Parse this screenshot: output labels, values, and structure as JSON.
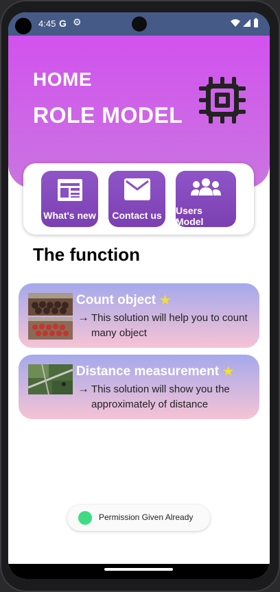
{
  "status": {
    "time": "4:45",
    "g_letter": "G",
    "gear": "⚙"
  },
  "header": {
    "home": "HOME",
    "role_model": "ROLE MODEL"
  },
  "menu": [
    {
      "label": "What's new",
      "icon": "newspaper-icon"
    },
    {
      "label": "Contact us",
      "icon": "mail-icon"
    },
    {
      "label": "Users Model",
      "icon": "users-icon"
    }
  ],
  "section_title": "The function",
  "functions": [
    {
      "title": "Count object",
      "star": "★",
      "description": "This solution will help you to count many object"
    },
    {
      "title": "Distance measurement",
      "star": "★",
      "description": "This solution will show you the approximately of distance"
    }
  ],
  "toast": {
    "text": "Permission Given Already"
  },
  "colors": {
    "accent": "#d252ee",
    "button": "#7b3fb1",
    "status_bar": "#455a86",
    "star": "#f5e027"
  }
}
